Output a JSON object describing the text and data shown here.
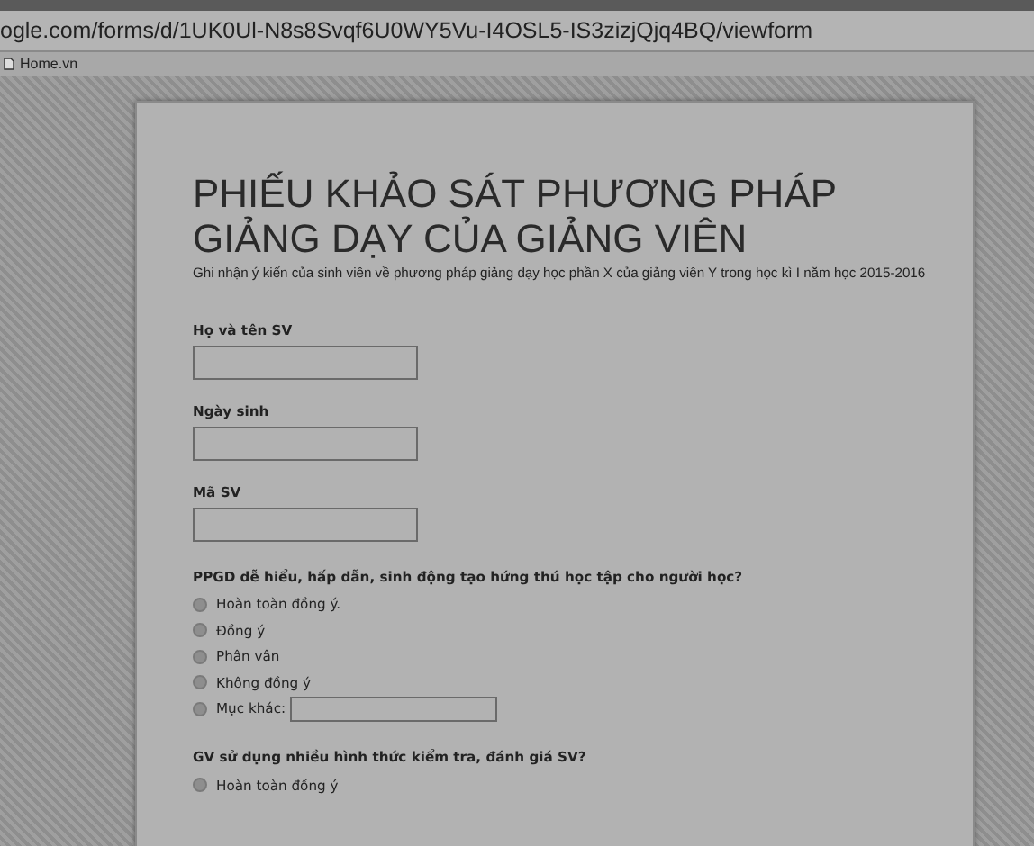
{
  "browser": {
    "url": "ogle.com/forms/d/1UK0Ul-N8s8Svqf6U0WY5Vu-I4OSL5-IS3zizjQjq4BQ/viewform",
    "bookmarks": [
      "Home.vn"
    ]
  },
  "form": {
    "title": "PHIẾU KHẢO SÁT PHƯƠNG PHÁP GIẢNG DẠY CỦA GIẢNG VIÊN",
    "description": "Ghi nhận ý kiến của sinh viên về phương pháp giảng dạy học phần X của giảng viên Y trong học kì I năm học 2015-2016",
    "questions": [
      {
        "kind": "text",
        "label": "Họ và tên SV"
      },
      {
        "kind": "text",
        "label": "Ngày sinh"
      },
      {
        "kind": "text",
        "label": "Mã SV"
      },
      {
        "kind": "choice",
        "label": "PPGD dễ hiểu, hấp dẫn, sinh động tạo hứng thú học tập cho người học?",
        "options": [
          {
            "label": "Hoàn toàn đồng ý.",
            "selected": false
          },
          {
            "label": "Đồng ý",
            "selected": false
          },
          {
            "label": "Phân vân",
            "selected": false
          },
          {
            "label": "Không đồng ý",
            "selected": false
          },
          {
            "label": "Mục khác:",
            "selected": false,
            "kind": "other"
          }
        ]
      },
      {
        "kind": "choice",
        "label": "GV sử dụng nhiều hình thức kiểm tra, đánh giá SV?",
        "options": [
          {
            "label": "Hoàn toàn đồng ý",
            "selected": false
          }
        ]
      }
    ]
  }
}
